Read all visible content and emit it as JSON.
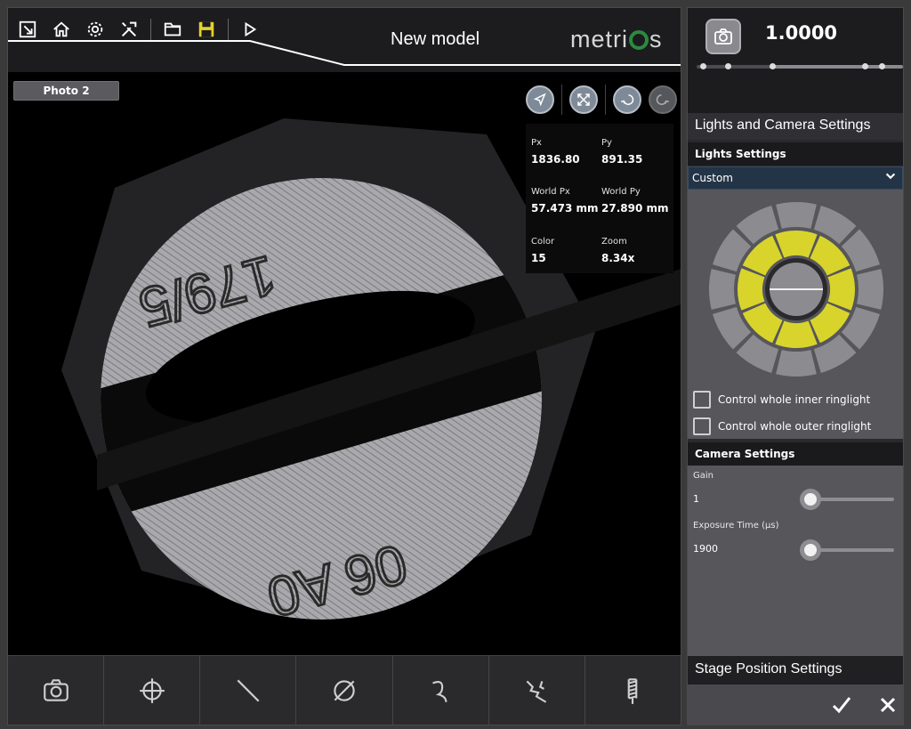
{
  "header": {
    "title": "New model",
    "logo": "metrios",
    "toolbar": [
      "exit-icon",
      "home-icon",
      "gear-icon",
      "tools-icon",
      "folder-icon",
      "save-icon",
      "play-icon"
    ]
  },
  "viewport": {
    "photo_tab": "Photo 2",
    "tools": [
      "pointer-icon",
      "fit-icon",
      "undo-icon",
      "redo-icon"
    ],
    "info": {
      "px_label": "Px",
      "px_value": "1836.80",
      "py_label": "Py",
      "py_value": "891.35",
      "wpx_label": "World Px",
      "wpx_value": "57.473 mm",
      "wpy_label": "World Py",
      "wpy_value": "27.890 mm",
      "color_label": "Color",
      "color_value": "15",
      "zoom_label": "Zoom",
      "zoom_value": "8.34x"
    },
    "image_text": {
      "top": "179/5",
      "bottom": "06 A0"
    }
  },
  "bottom_tools": [
    "camera-icon",
    "crosshair-icon",
    "line-icon",
    "diameter-icon",
    "curve-icon",
    "crack-icon",
    "thread-icon"
  ],
  "right_panel": {
    "zoom_value": "1.0000",
    "zoom_slider_fraction": 0.33,
    "section_title": "Lights and Camera Settings",
    "lights_header": "Lights Settings",
    "lights_preset": "Custom",
    "inner_ring_checkbox": "Control whole inner ringlight",
    "outer_ring_checkbox": "Control whole outer ringlight",
    "camera_header": "Camera Settings",
    "gain_label": "Gain",
    "gain_value": "1",
    "gain_fraction": 0.0,
    "exposure_label": "Exposure Time (µs)",
    "exposure_value": "1900",
    "exposure_fraction": 0.0,
    "stage_title": "Stage Position Settings",
    "ring_colors": {
      "on": "#d8d42c",
      "off": "#8c8c90"
    }
  }
}
